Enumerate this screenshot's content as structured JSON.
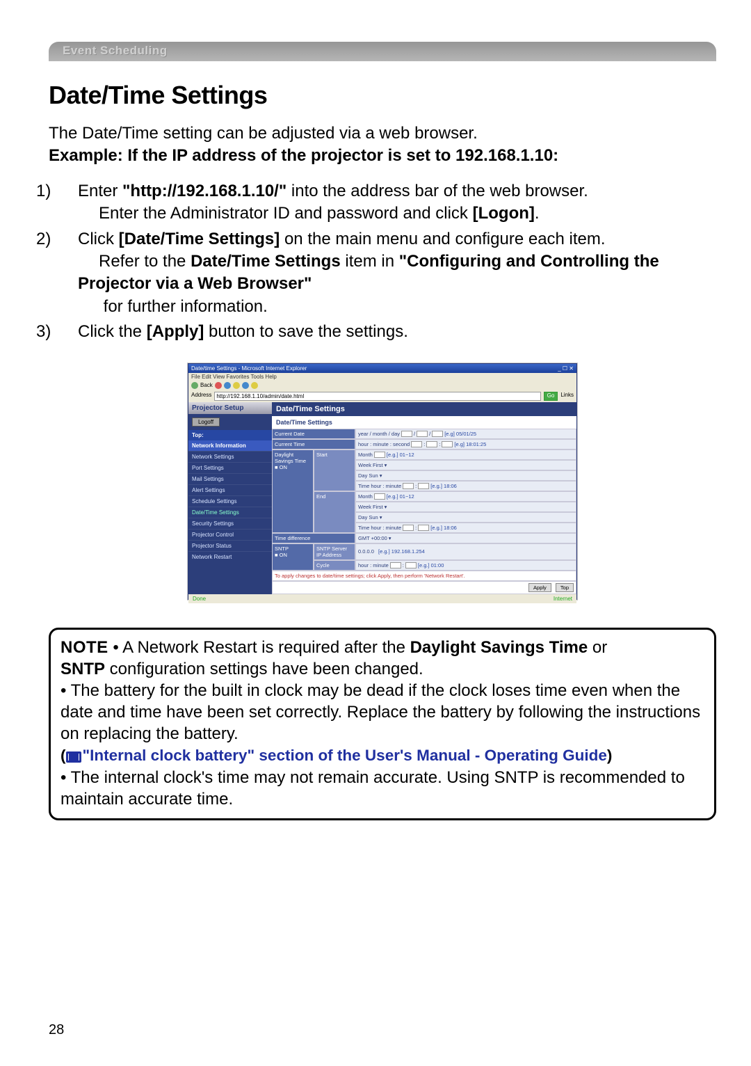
{
  "page_number": "28",
  "header_bar": "Event Scheduling",
  "title": "Date/Time Settings",
  "intro_line1": "The Date/Time setting can be adjusted via a web browser.",
  "intro_line2": "Example: If the IP address of the projector is set to 192.168.1.10:",
  "steps": {
    "s1_n": "1) ",
    "s1a": "Enter ",
    "s1b": "\"http://192.168.1.10/\"",
    "s1c": " into the address bar of the web browser.",
    "s1d": "Enter the Administrator ID and password and click ",
    "s1e": "[Logon]",
    "s1f": ".",
    "s2_n": "2) ",
    "s2a": "Click ",
    "s2b": "[Date/Time Settings]",
    "s2c": " on the main menu and configure each item.",
    "s2d": "Refer to the ",
    "s2e": "Date/Time Settings",
    "s2f": " item in ",
    "s2g": "\"Configuring and Controlling the Projector via a Web Browser\"",
    "s2h": " for further information.",
    "s3_n": "3) ",
    "s3a": "Click the ",
    "s3b": "[Apply]",
    "s3c": " button to save the settings."
  },
  "screenshot": {
    "window_title": "Date/time Settings - Microsoft Internet Explorer",
    "menu": "File  Edit  View  Favorites  Tools  Help",
    "back": "Back",
    "addr_label": "Address",
    "addr_value": "http://192.168.1.10/admin/date.html",
    "go": "Go",
    "links": "Links",
    "ps_title": "Projector Setup",
    "logoff": "Logoff",
    "sb_top": "Top:",
    "sb_netinfo": "Network Information",
    "sidebar_items": [
      "Network Settings",
      "Port Settings",
      "Mail Settings",
      "Alert Settings",
      "Schedule Settings",
      "Date/Time Settings",
      "Security Settings",
      "Projector Control",
      "Projector Status",
      "Network Restart"
    ],
    "mp_title": "Date/Time Settings",
    "mp_sub": "Date/Time Settings",
    "rows": {
      "curdate_l": "Current Date",
      "curdate_v": "year / month / day",
      "curdate_eg": "[e.g] 05/01/25",
      "curtime_l": "Current Time",
      "curtime_v": "hour : minute : second",
      "curtime_eg": "[e.g] 18:01:25",
      "dst_l": "Daylight Savings Time",
      "dst_on": "■ ON",
      "start_l": "Start",
      "end_l": "End",
      "month": "Month",
      "month_eg": "[e.g.] 01~12",
      "week": "Week",
      "week_v": "First",
      "day": "Day",
      "day_v": "Sun",
      "time": "Time",
      "time_v": "hour : minute",
      "time_eg": "[e.g.] 18:06",
      "tdiff_l": "Time difference",
      "tdiff_v": "GMT +00:00",
      "sntp_l": "SNTP",
      "sntp_on": "■ ON",
      "sntp_ip_l": "SNTP Server IP Address",
      "sntp_ip_v": "0.0.0.0",
      "sntp_ip_eg": "[e.g.] 192.168.1.254",
      "cycle_l": "Cycle",
      "cycle_v": "hour : minute",
      "cycle_eg": "[e.g.] 01:00"
    },
    "warn": "To apply changes to date/time settings; click Apply, then perform 'Network Restart'.",
    "apply": "Apply",
    "top": "Top",
    "status_done": "Done",
    "status_net": "Internet"
  },
  "note": {
    "label": "NOTE",
    "n1a": "  • A Network Restart is required after the ",
    "n1b": "Daylight Savings Time",
    "n1c": " or ",
    "n1d": "SNTP",
    "n1e": " configuration settings have been changed.",
    "n2": "• The battery for the built in clock may be dead if the clock loses time even when the date and time have been set correctly. Replace the battery by following the instructions on replacing the battery.",
    "n3_pre": "(",
    "n3": "\"Internal clock battery\" section of the User's Manual - Operating Guide",
    "n3_post": ")",
    "n4": "• The internal clock's time may not remain accurate. Using SNTP is recommended to maintain accurate time."
  }
}
